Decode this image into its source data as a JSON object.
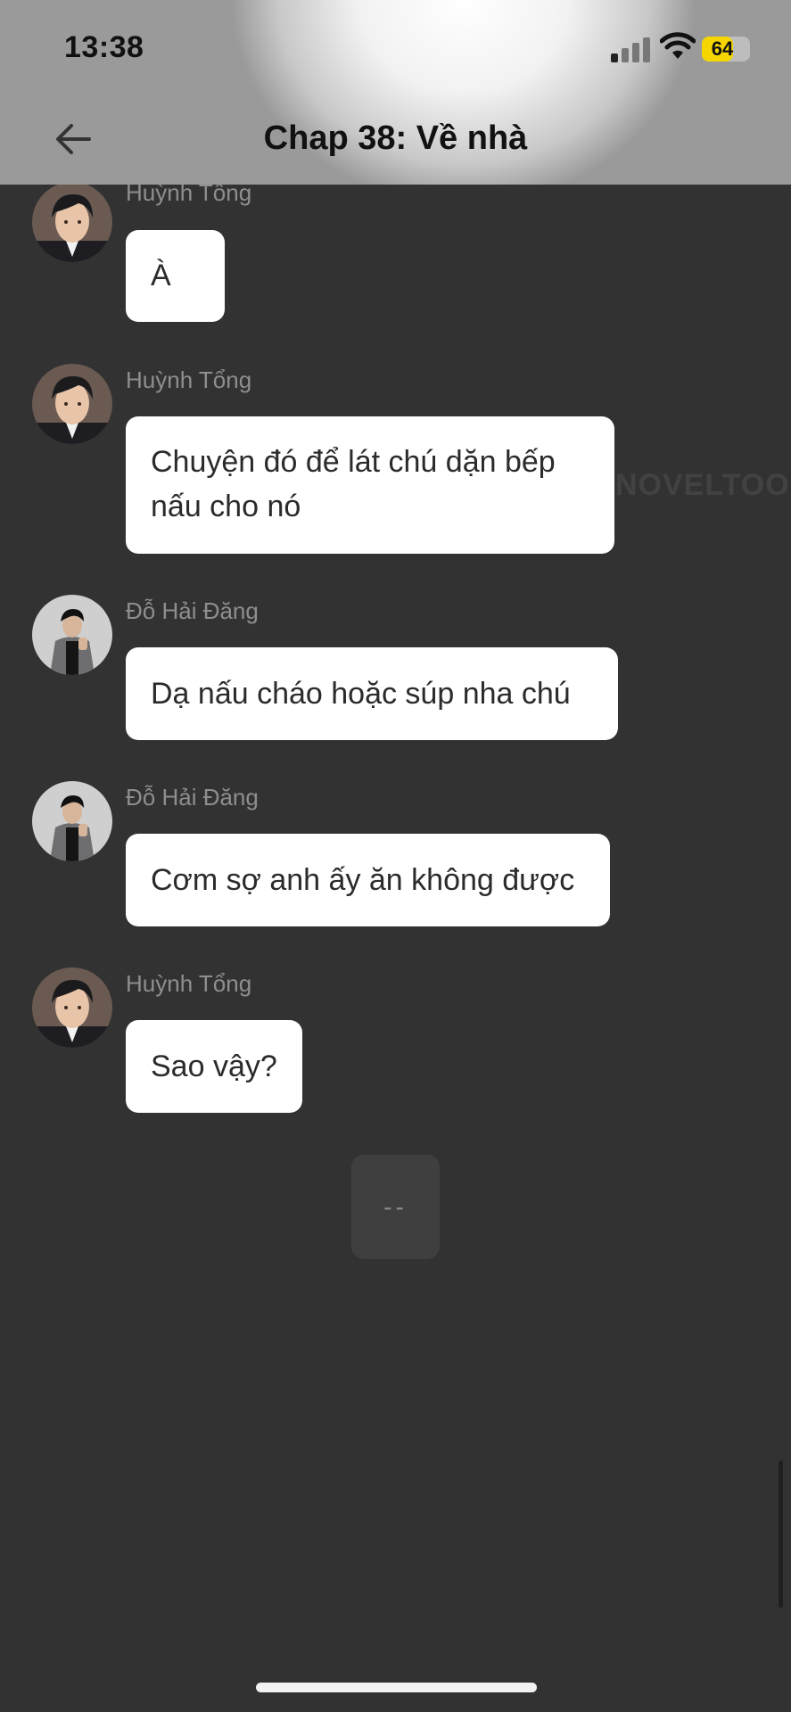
{
  "status_bar": {
    "time": "13:38",
    "battery_level": 64,
    "battery_label": "64"
  },
  "header": {
    "title": "Chap 38: Về nhà",
    "back_icon": "arrow-left-icon"
  },
  "watermark": "NOVELTOON",
  "messages": [
    {
      "sender": "Huỳnh Tổng",
      "avatar": "avatar-huynh-tong",
      "lines": [
        "À"
      ]
    },
    {
      "sender": "Huỳnh Tổng",
      "avatar": "avatar-huynh-tong",
      "lines": [
        "Chuyện đó để lát chú dặn bếp",
        "nấu cho nó"
      ]
    },
    {
      "sender": "Đỗ Hải Đăng",
      "avatar": "avatar-do-hai-dang",
      "lines": [
        "Dạ nấu cháo hoặc súp nha chú"
      ]
    },
    {
      "sender": "Đỗ Hải Đăng",
      "avatar": "avatar-do-hai-dang",
      "lines": [
        "Cơm sợ anh ấy ăn không được"
      ]
    },
    {
      "sender": "Huỳnh Tổng",
      "avatar": "avatar-huynh-tong",
      "lines": [
        "Sao vậy?"
      ]
    }
  ],
  "loading_indicator": "--",
  "colors": {
    "background": "#323232",
    "bubble": "#ffffff",
    "sender_text": "#8e8e8e",
    "battery": "#f5d600"
  }
}
